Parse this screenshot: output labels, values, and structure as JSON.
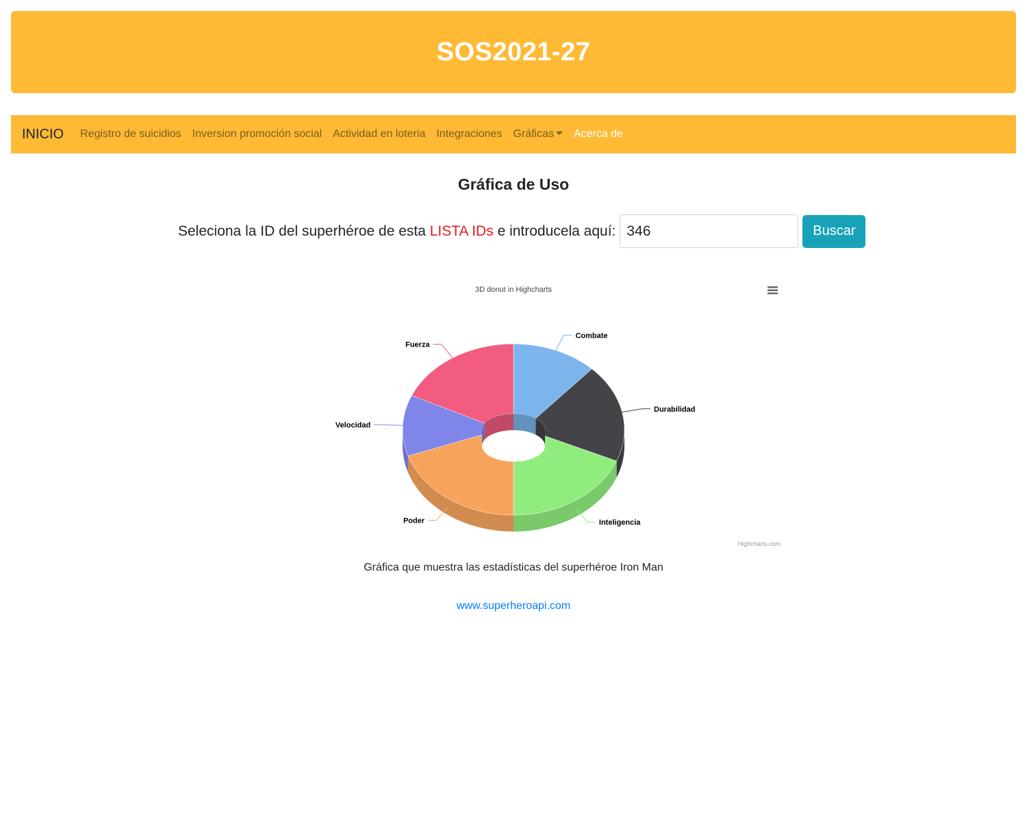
{
  "banner": {
    "title": "SOS2021-27",
    "color": "#ffba35"
  },
  "navbar": {
    "brand": "INICIO",
    "items": [
      {
        "label": "Registro de suicidios"
      },
      {
        "label": "Inversion promoción social"
      },
      {
        "label": "Actividad en loteria"
      },
      {
        "label": "Integraciones"
      },
      {
        "label": "Gráficas",
        "dropdown": true
      },
      {
        "label": "Acerca de",
        "active": true
      }
    ]
  },
  "page": {
    "title": "Gráfica de Uso",
    "search": {
      "label_before": "Seleciona la ID del superhéroe de esta ",
      "link_text": "LISTA IDs",
      "label_after": " e introducela aquí:",
      "value": "346",
      "button_label": "Buscar"
    },
    "caption": "Gráfica que muestra las estadísticas del superhéroe Iron Man",
    "footer_link": "www.superheroapi.com"
  },
  "chart_data": {
    "type": "pie",
    "variant": "3d-donut",
    "title": "3D donut in Highcharts",
    "credits": "Highcharts.com",
    "menu_icon": "hamburger-menu-icon",
    "slices": [
      {
        "name": "Combate",
        "value": 12.5,
        "color": "#7cb5ec"
      },
      {
        "name": "Durabilidad",
        "value": 18.5,
        "color": "#434348"
      },
      {
        "name": "Inteligencia",
        "value": 19,
        "color": "#90ed7d"
      },
      {
        "name": "Poder",
        "value": 20,
        "color": "#f7a35c"
      },
      {
        "name": "Velocidad",
        "value": 11.5,
        "color": "#8085e9"
      },
      {
        "name": "Fuerza",
        "value": 18.5,
        "color": "#f15c80"
      }
    ]
  }
}
